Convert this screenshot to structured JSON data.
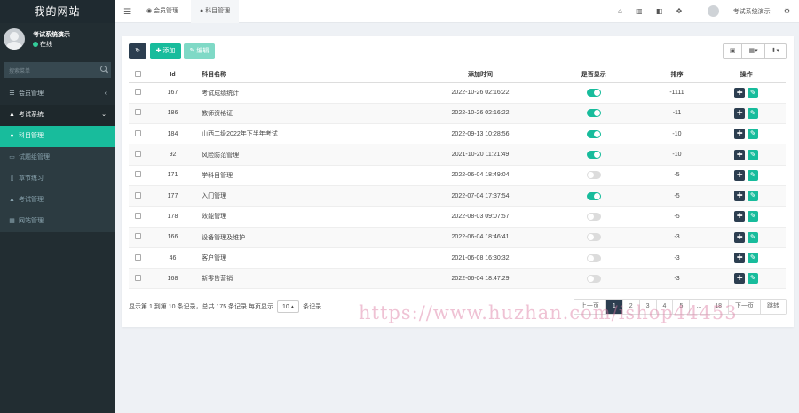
{
  "sidebar": {
    "logo": "我的网站",
    "user": {
      "name": "考试系统演示",
      "status": "在线"
    },
    "search_placeholder": "搜索菜单",
    "items": [
      {
        "label": "会员管理",
        "icon": "list-icon",
        "arrow": "‹"
      },
      {
        "label": "考试系统",
        "icon": "graduation-cap-icon",
        "arrow": "⌄"
      },
      {
        "label": "科目管理",
        "icon": "map-marker-icon"
      },
      {
        "label": "试题组管理",
        "icon": "image-icon"
      },
      {
        "label": "章节练习",
        "icon": "book-icon"
      },
      {
        "label": "考试管理",
        "icon": "graduation-cap-icon"
      },
      {
        "label": "网站管理",
        "icon": "table-icon"
      }
    ]
  },
  "topbar": {
    "menu_icon": "hamburger-icon",
    "tabs": [
      {
        "label": "会员管理",
        "icon": "user-icon"
      },
      {
        "label": "科目管理",
        "icon": "map-marker-icon"
      }
    ],
    "icons": [
      "home-icon",
      "trash-icon",
      "translate-icon",
      "fullscreen-icon"
    ],
    "user_name": "考试系统演示",
    "settings_icon": "gears-icon"
  },
  "toolbar": {
    "refresh_icon": "refresh-icon",
    "add_label": "✚ 添加",
    "edit_label": "✎ 编辑",
    "right_tools": [
      "▣",
      "▦▾",
      "⬇▾"
    ]
  },
  "table": {
    "headers": [
      "Id",
      "科目名称",
      "添加时间",
      "是否显示",
      "排序",
      "操作"
    ],
    "rows": [
      {
        "id": "167",
        "name": "考试成绩统计",
        "time": "2022-10-26 02:16:22",
        "show": true,
        "sort": "-1111"
      },
      {
        "id": "186",
        "name": "教师资格证",
        "time": "2022-10-26 02:16:22",
        "show": true,
        "sort": "-11"
      },
      {
        "id": "184",
        "name": "山西二级2022年下半年考试",
        "time": "2022-09-13 10:28:56",
        "show": true,
        "sort": "-10"
      },
      {
        "id": "92",
        "name": "风险防范管理",
        "time": "2021-10-20 11:21:49",
        "show": true,
        "sort": "-10"
      },
      {
        "id": "171",
        "name": "学科目管理",
        "time": "2022-06-04 18:49:04",
        "show": false,
        "sort": "-5"
      },
      {
        "id": "177",
        "name": "入门管理",
        "time": "2022-07-04 17:37:54",
        "show": true,
        "sort": "-5"
      },
      {
        "id": "178",
        "name": "效能管理",
        "time": "2022-08-03 09:07:57",
        "show": false,
        "sort": "-5"
      },
      {
        "id": "166",
        "name": "设备管理及维护",
        "time": "2022-06-04 18:46:41",
        "show": false,
        "sort": "-3"
      },
      {
        "id": "46",
        "name": "客户管理",
        "time": "2021-06-08 16:30:32",
        "show": false,
        "sort": "-3"
      },
      {
        "id": "168",
        "name": "新零售营销",
        "time": "2022-06-04 18:47:29",
        "show": false,
        "sort": "-3"
      }
    ]
  },
  "footer": {
    "info_prefix": "显示第 1 到第 10 条记录，总共 175 条记录 每页显示",
    "page_size": "10 ▴",
    "info_suffix": "条记录",
    "pager": [
      "上一页",
      "1",
      "2",
      "3",
      "4",
      "5",
      "...",
      "18",
      "下一页",
      "跳转"
    ]
  },
  "watermark": "https://www.huzhan.com/ishop44453"
}
